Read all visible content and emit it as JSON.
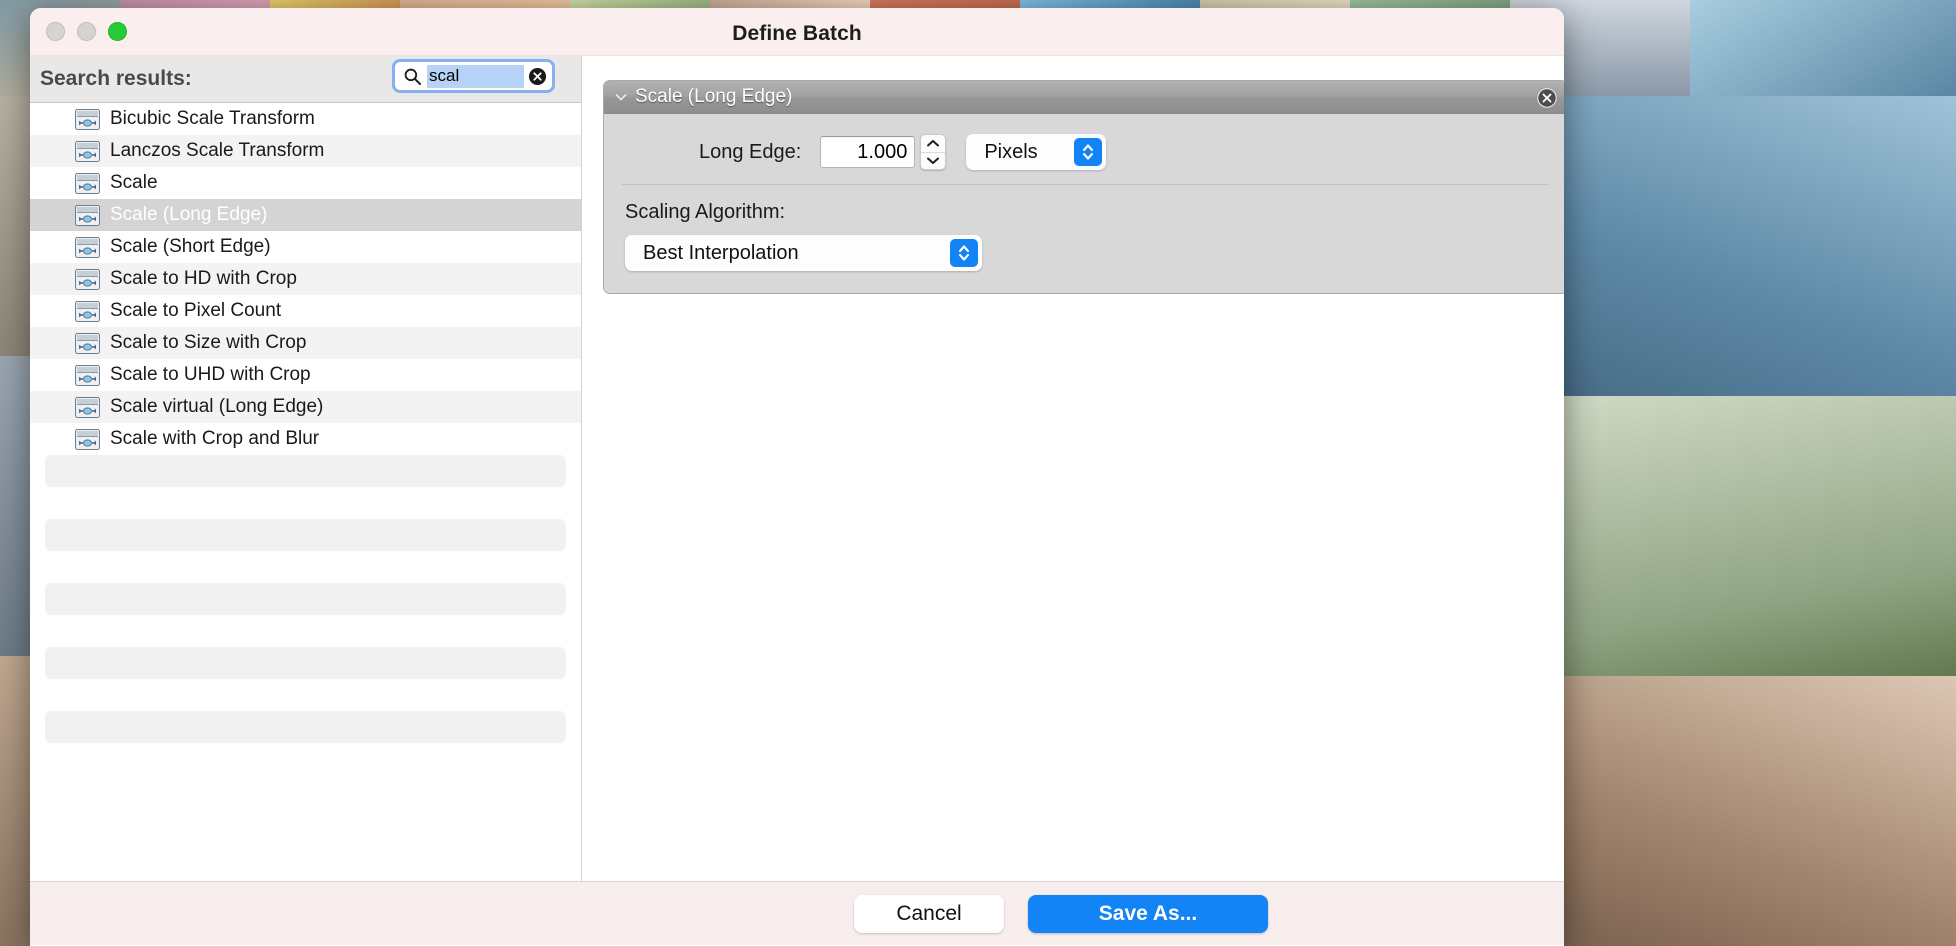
{
  "window": {
    "title": "Define Batch",
    "traffic_lights": [
      {
        "name": "close-button",
        "color": "#d7d3d2",
        "state": "disabled"
      },
      {
        "name": "minimize-button",
        "color": "#d7d3d2",
        "state": "disabled"
      },
      {
        "name": "maximize-button",
        "color": "#25cc36",
        "state": "enabled"
      }
    ]
  },
  "left_pane": {
    "header_label": "Search results:",
    "search": {
      "icon": "search-icon",
      "value": "scal",
      "placeholder": "Search",
      "clear_icon": "clear-circle-icon",
      "focused": true,
      "text_selected": true,
      "focus_ring_color": "#86b1ee",
      "selection_color": "#b6d3f7"
    },
    "list_icon": "slider-adjust-icon",
    "items": [
      {
        "label": "Bicubic Scale Transform",
        "selected": false
      },
      {
        "label": "Lanczos Scale Transform",
        "selected": false
      },
      {
        "label": "Scale",
        "selected": false
      },
      {
        "label": "Scale (Long Edge)",
        "selected": true
      },
      {
        "label": "Scale (Short Edge)",
        "selected": false
      },
      {
        "label": "Scale to HD with Crop",
        "selected": false
      },
      {
        "label": "Scale to Pixel Count",
        "selected": false
      },
      {
        "label": "Scale to Size with Crop",
        "selected": false
      },
      {
        "label": "Scale to UHD with Crop",
        "selected": false
      },
      {
        "label": "Scale virtual (Long Edge)",
        "selected": false
      },
      {
        "label": "Scale with Crop and Blur",
        "selected": false
      }
    ],
    "empty_rows": 9,
    "selected_row_bg": "#d4d4d4"
  },
  "inspector": {
    "title": "Scale (Long Edge)",
    "disclosure_icon": "chevron-down-icon",
    "close_icon": "close-circle-icon",
    "expanded": true,
    "fields": [
      {
        "label": "Long Edge:",
        "type": "number-with-stepper-and-unit",
        "value": "1.000",
        "stepper_icon": "stepper-up-down-icon",
        "unit": {
          "value": "Pixels",
          "arrow_icon": "popup-up-down-icon",
          "accent": "#1384f5"
        }
      },
      {
        "label": "Scaling Algorithm:",
        "type": "popup",
        "value": "Best Interpolation",
        "arrow_icon": "popup-up-down-icon",
        "accent": "#1384f5"
      }
    ]
  },
  "footer": {
    "cancel_label": "Cancel",
    "save_label": "Save As...",
    "primary_color": "#1384f5"
  }
}
